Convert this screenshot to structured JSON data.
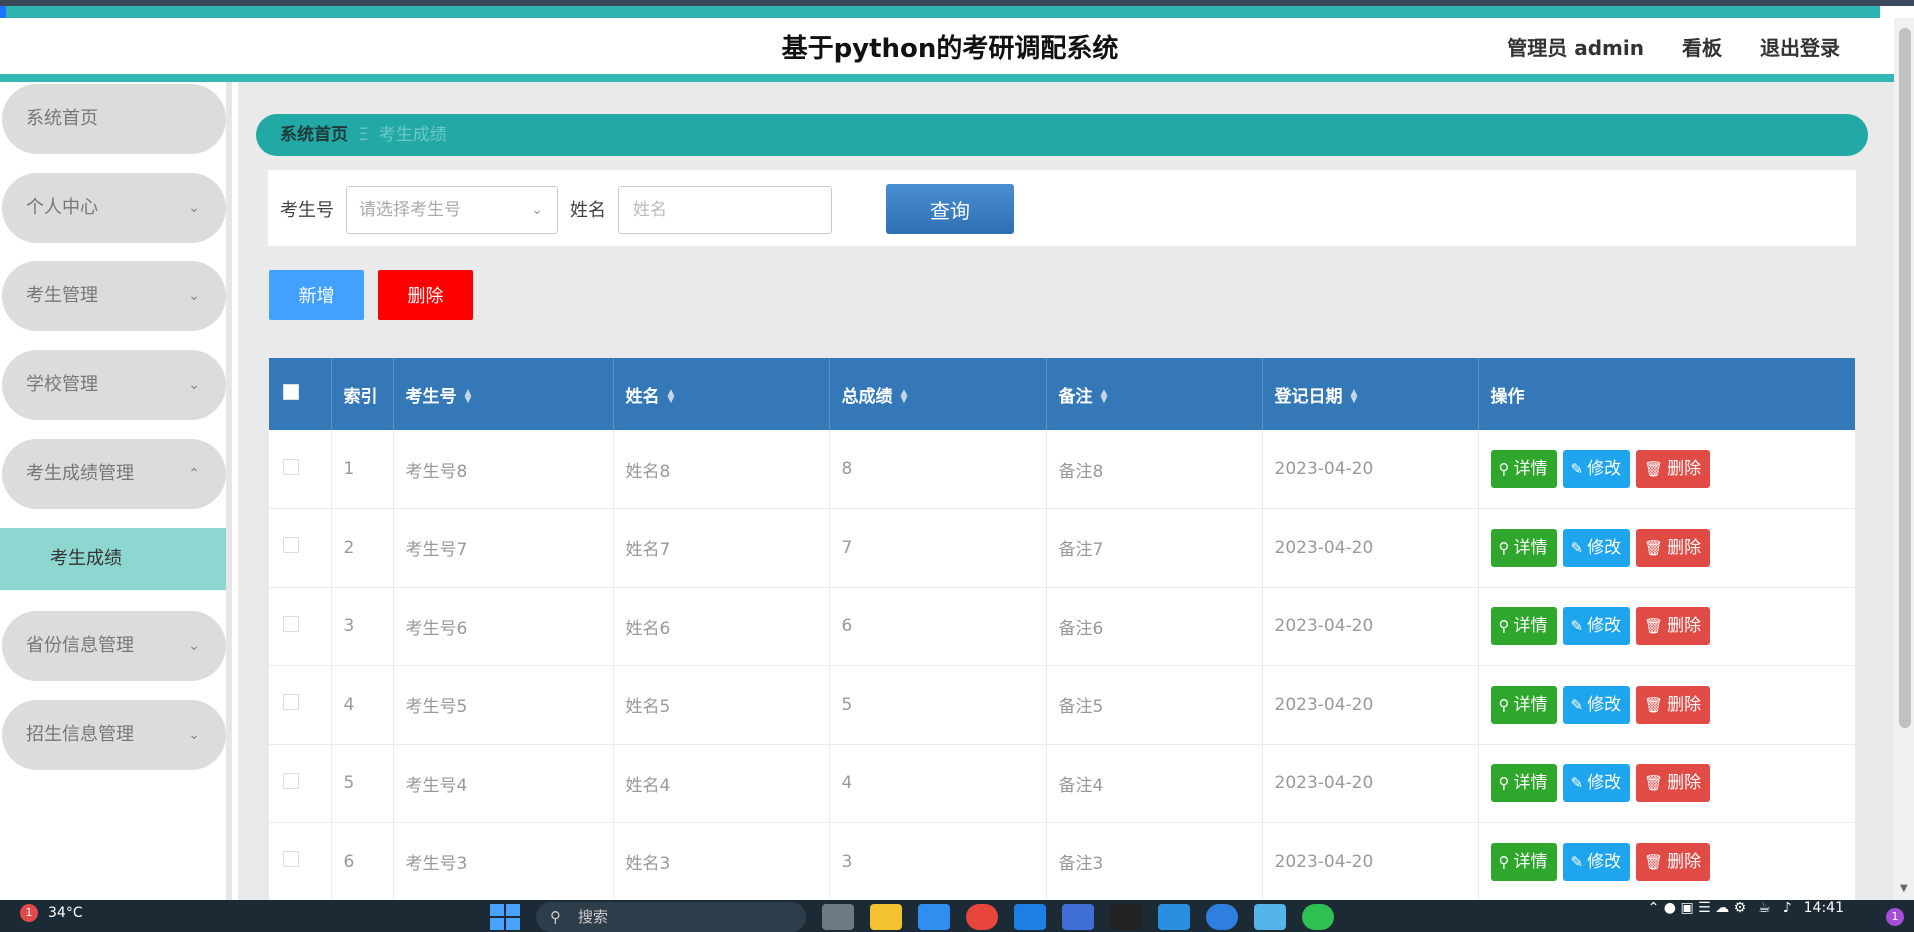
{
  "header": {
    "title": "基于python的考研调配系统",
    "user": "管理员 admin",
    "board": "看板",
    "logout": "退出登录"
  },
  "sidebar": {
    "items": [
      {
        "label": "系统首页",
        "icon": ""
      },
      {
        "label": "个人中心",
        "icon": "chevron-down-icon"
      },
      {
        "label": "考生管理",
        "icon": "chevron-down-icon"
      },
      {
        "label": "学校管理",
        "icon": "chevron-down-icon"
      },
      {
        "label": "考生成绩管理",
        "icon": "chevron-up-icon"
      },
      {
        "label": "省份信息管理",
        "icon": "chevron-down-icon"
      },
      {
        "label": "招生信息管理",
        "icon": "chevron-down-icon"
      }
    ],
    "sub_item": "考生成绩"
  },
  "breadcrumb": {
    "home": "系统首页",
    "separator": "Ξ",
    "current": "考生成绩"
  },
  "search": {
    "exam_no_label": "考生号",
    "exam_no_placeholder": "请选择考生号",
    "name_label": "姓名",
    "name_placeholder": "姓名",
    "query_button": "查询"
  },
  "actions": {
    "add": "新增",
    "delete": "删除"
  },
  "table": {
    "headers": {
      "index": "索引",
      "exam_no": "考生号",
      "name": "姓名",
      "score": "总成绩",
      "remark": "备注",
      "date": "登记日期",
      "ops": "操作"
    },
    "row_buttons": {
      "detail": "详情",
      "edit": "修改",
      "delete": "删除"
    },
    "rows": [
      {
        "index": "1",
        "exam_no": "考生号8",
        "name": "姓名8",
        "score": "8",
        "remark": "备注8",
        "date": "2023-04-20"
      },
      {
        "index": "2",
        "exam_no": "考生号7",
        "name": "姓名7",
        "score": "7",
        "remark": "备注7",
        "date": "2023-04-20"
      },
      {
        "index": "3",
        "exam_no": "考生号6",
        "name": "姓名6",
        "score": "6",
        "remark": "备注6",
        "date": "2023-04-20"
      },
      {
        "index": "4",
        "exam_no": "考生号5",
        "name": "姓名5",
        "score": "5",
        "remark": "备注5",
        "date": "2023-04-20"
      },
      {
        "index": "5",
        "exam_no": "考生号4",
        "name": "姓名4",
        "score": "4",
        "remark": "备注4",
        "date": "2023-04-20"
      },
      {
        "index": "6",
        "exam_no": "考生号3",
        "name": "姓名3",
        "score": "3",
        "remark": "备注3",
        "date": "2023-04-20"
      }
    ]
  },
  "taskbar": {
    "weather_badge": "1",
    "temperature": "34°C",
    "search_placeholder": "搜索",
    "time": "14:41",
    "notification_badge": "1"
  },
  "colors": {
    "teal": "#2fb3b0",
    "header_blue": "#3478b8",
    "detail_green": "#2fa72c",
    "edit_blue": "#1fa5ee",
    "delete_red": "#e04b45"
  }
}
